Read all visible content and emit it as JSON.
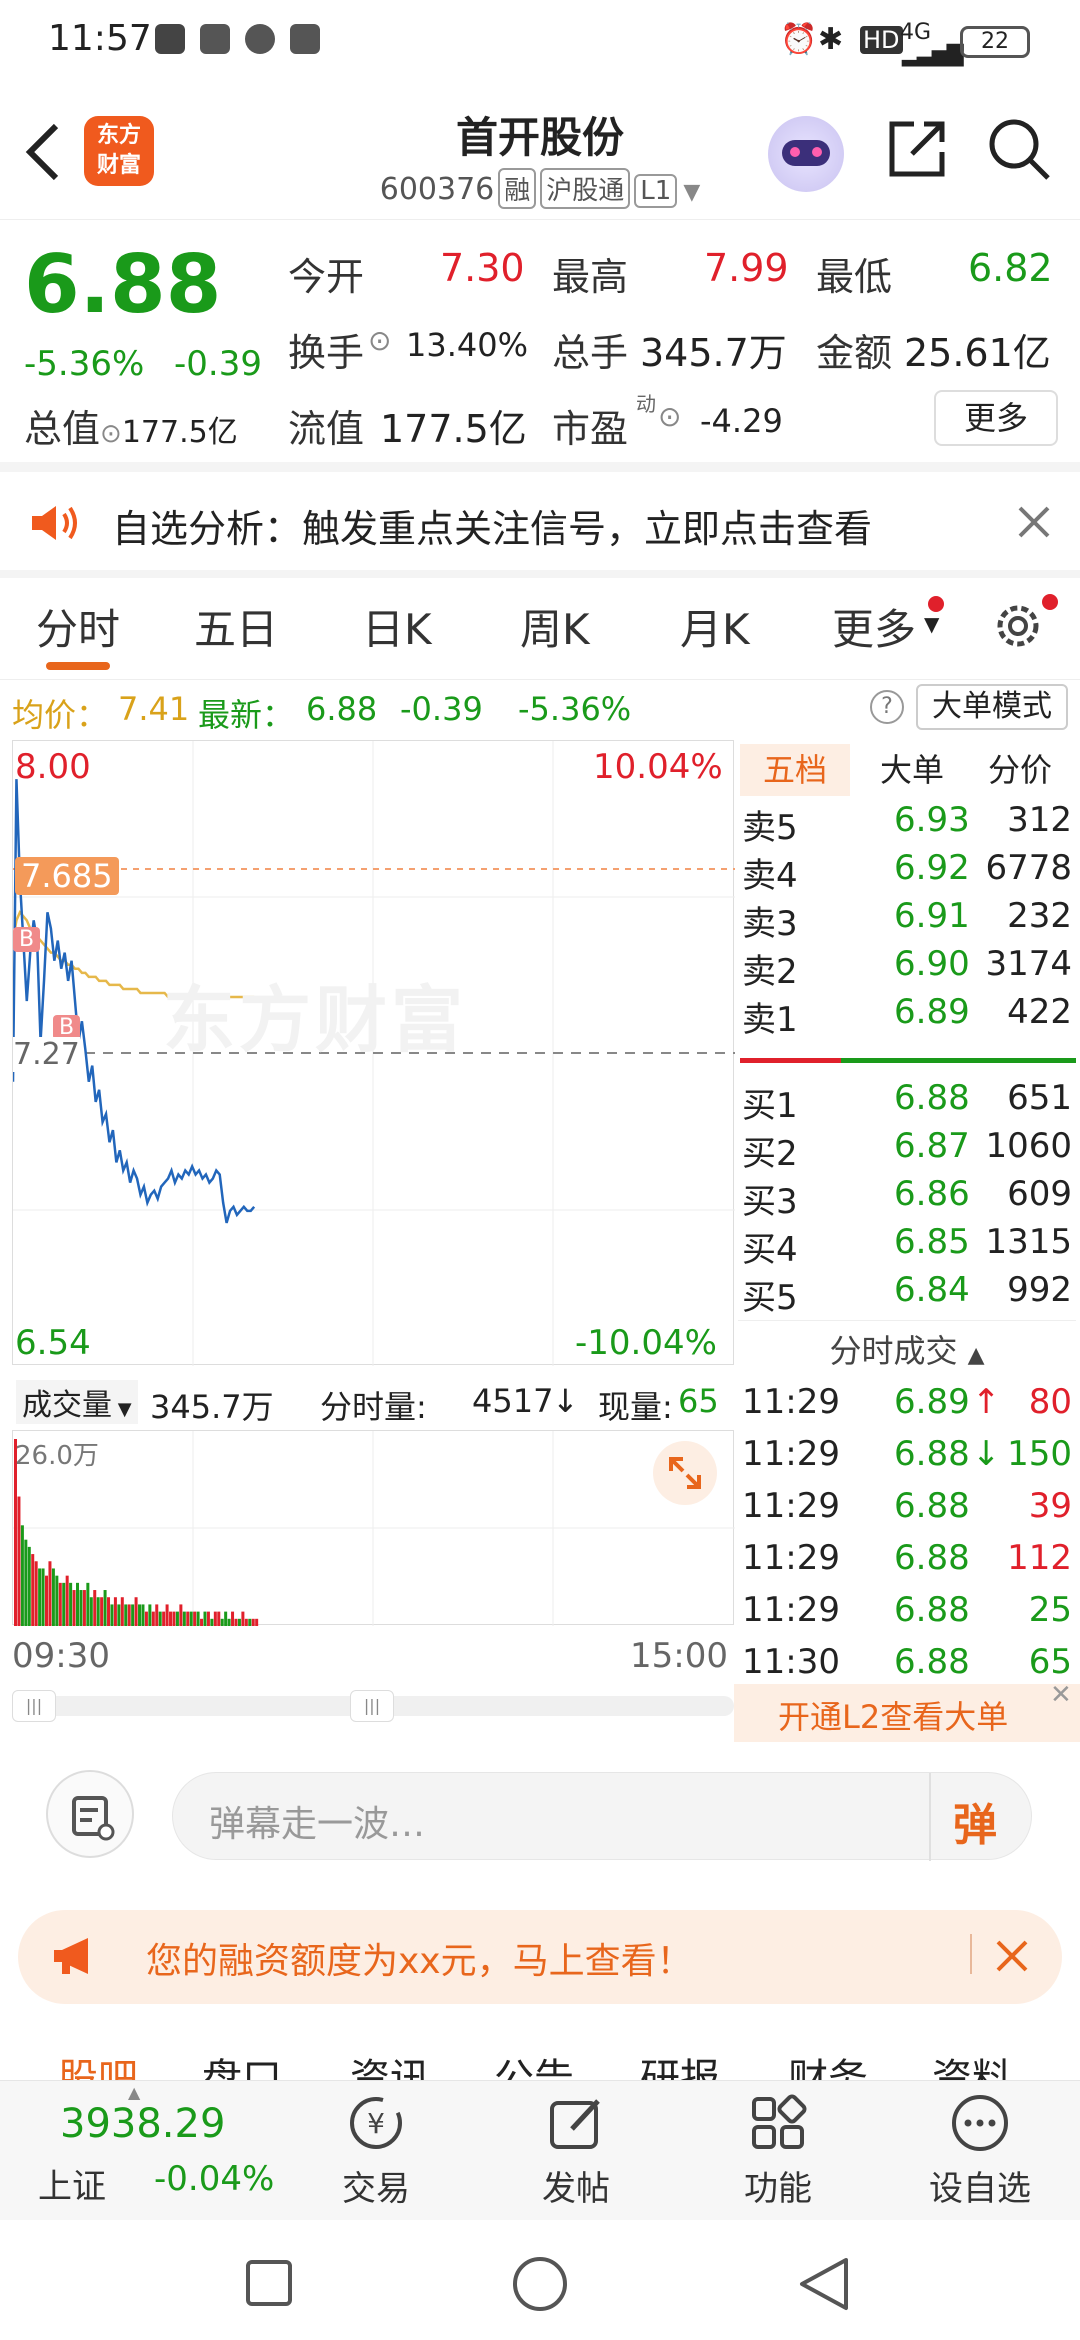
{
  "status": {
    "time": "11:57",
    "battery": "22",
    "net": "4G",
    "hd": "HD"
  },
  "header": {
    "logo_line1": "东方",
    "logo_line2": "财富",
    "title": "首开股份",
    "code": "600376",
    "tag1": "融",
    "tag2": "沪股通",
    "tag3": "L1"
  },
  "quote": {
    "price": "6.88",
    "pct": "-5.36%",
    "chg": "-0.39",
    "open_label": "今开",
    "open": "7.30",
    "high_label": "最高",
    "high": "7.99",
    "low_label": "最低",
    "low": "6.82",
    "turnover_label": "换手",
    "turnover": "13.40%",
    "vol_label": "总手",
    "vol": "345.7万",
    "amount_label": "金额",
    "amount": "25.61亿",
    "mcap_label": "总值",
    "mcap": "177.5亿",
    "float_label": "流值",
    "float": "177.5亿",
    "pe_label": "市盈",
    "pe_sup": "动",
    "pe": "-4.29",
    "more": "更多"
  },
  "notice": {
    "text": "自选分析：触发重点关注信号，立即点击查看"
  },
  "tabs": [
    "分时",
    "五日",
    "日K",
    "周K",
    "月K",
    "更多"
  ],
  "infoline": {
    "avg_label": "均价：",
    "avg": "7.41",
    "latest_label": "最新：",
    "latest": "6.88",
    "chg": "-0.39",
    "pct": "-5.36%",
    "mode": "大单模式"
  },
  "chart": {
    "top_price": "8.00",
    "top_pct": "10.04%",
    "bottom_price": "6.54",
    "bottom_pct": "-10.04%",
    "mid": "7.27",
    "marker": "7.685",
    "b": "B",
    "watermark": "东方财富",
    "start_time": "09:30",
    "end_time": "15:00"
  },
  "chart_data": {
    "type": "line",
    "ylim": [
      6.54,
      8.0
    ],
    "prev_close": 7.27,
    "price": [
      7.2,
      7.95,
      7.7,
      7.55,
      7.4,
      7.52,
      7.6,
      7.55,
      7.3,
      7.45,
      7.62,
      7.58,
      7.5,
      7.55,
      7.48,
      7.52,
      7.45,
      7.5,
      7.4,
      7.3,
      7.35,
      7.28,
      7.2,
      7.24,
      7.15,
      7.18,
      7.1,
      7.12,
      7.05,
      7.08,
      7.0,
      7.03,
      6.98,
      7.0,
      6.95,
      6.98,
      6.96,
      6.92,
      6.94,
      6.9,
      6.92,
      6.93,
      6.91,
      6.94,
      6.95,
      6.96,
      6.98,
      6.95,
      6.97,
      6.96,
      6.98,
      6.97,
      6.99,
      6.97,
      6.98,
      6.96,
      6.97,
      6.95,
      6.96,
      6.98,
      6.97,
      6.9,
      6.85,
      6.88,
      6.89,
      6.87,
      6.88,
      6.89,
      6.88,
      6.88,
      6.89
    ],
    "avg": [
      7.55,
      7.6,
      7.62,
      7.61,
      7.6,
      7.58,
      7.57,
      7.56,
      7.55,
      7.54,
      7.53,
      7.52,
      7.52,
      7.51,
      7.5,
      7.5,
      7.49,
      7.49,
      7.48,
      7.48,
      7.47,
      7.47,
      7.46,
      7.46,
      7.46,
      7.45,
      7.45,
      7.45,
      7.44,
      7.44,
      7.44,
      7.44,
      7.43,
      7.43,
      7.43,
      7.43,
      7.43,
      7.42,
      7.42,
      7.42,
      7.42,
      7.42,
      7.42,
      7.42,
      7.42,
      7.41,
      7.41,
      7.41,
      7.41,
      7.41,
      7.41,
      7.41,
      7.41,
      7.41,
      7.41,
      7.41,
      7.41,
      7.41,
      7.41,
      7.41,
      7.41,
      7.41,
      7.41,
      7.41,
      7.41,
      7.41,
      7.41,
      7.41,
      7.41,
      7.41,
      7.41
    ],
    "volume": [
      26,
      18,
      14,
      12,
      11,
      10,
      9,
      8,
      8,
      7,
      9,
      8,
      7,
      6,
      6,
      7,
      6,
      5,
      6,
      5,
      5,
      6,
      4,
      5,
      4,
      4,
      5,
      4,
      3,
      4,
      3,
      4,
      3,
      3,
      3,
      4,
      3,
      3,
      2,
      3,
      2,
      3,
      2,
      2,
      3,
      2,
      2,
      2,
      3,
      2,
      2,
      2,
      2,
      2,
      1,
      2,
      2,
      1,
      2,
      2,
      1,
      2,
      1,
      2,
      1,
      1,
      2,
      1,
      1,
      1,
      1
    ],
    "vol_max_label": "26.0万"
  },
  "volbar": {
    "label": "成交量",
    "total": "345.7万",
    "fenshi_label": "分时量:",
    "fenshi": "4517",
    "arrow": "↓",
    "now_label": "现量:",
    "now": "65"
  },
  "book": {
    "tabs": [
      "五档",
      "大单",
      "分价"
    ],
    "asks": [
      {
        "l": "卖5",
        "p": "6.93",
        "v": "312"
      },
      {
        "l": "卖4",
        "p": "6.92",
        "v": "6778"
      },
      {
        "l": "卖3",
        "p": "6.91",
        "v": "232"
      },
      {
        "l": "卖2",
        "p": "6.90",
        "v": "3174"
      },
      {
        "l": "卖1",
        "p": "6.89",
        "v": "422"
      }
    ],
    "bids": [
      {
        "l": "买1",
        "p": "6.88",
        "v": "651"
      },
      {
        "l": "买2",
        "p": "6.87",
        "v": "1060"
      },
      {
        "l": "买3",
        "p": "6.86",
        "v": "609"
      },
      {
        "l": "买4",
        "p": "6.85",
        "v": "1315"
      },
      {
        "l": "买5",
        "p": "6.84",
        "v": "992"
      }
    ],
    "trades_title": "分时成交",
    "trades": [
      {
        "t": "11:29",
        "p": "6.89",
        "a": "↑",
        "v": "80"
      },
      {
        "t": "11:29",
        "p": "6.88",
        "a": "↓",
        "v": "150"
      },
      {
        "t": "11:29",
        "p": "6.88",
        "a": "",
        "v": "39"
      },
      {
        "t": "11:29",
        "p": "6.88",
        "a": "",
        "v": "112"
      },
      {
        "t": "11:29",
        "p": "6.88",
        "a": "",
        "v": "25"
      },
      {
        "t": "11:30",
        "p": "6.88",
        "a": "",
        "v": "65"
      }
    ],
    "l2": "开通L2查看大单"
  },
  "danmu": {
    "placeholder": "弹幕走一波…",
    "btn": "弹"
  },
  "ad": {
    "text": "您的融资额度为xx元，马上查看！"
  },
  "bottomtabs": [
    "股吧",
    "盘口",
    "资讯",
    "公告",
    "研报",
    "财务",
    "资料"
  ],
  "bottomnav": {
    "index": "3938.29",
    "index_name": "上证",
    "index_pct": "-0.04%",
    "trade": "交易",
    "post": "发帖",
    "func": "功能",
    "addfav": "设自选"
  }
}
